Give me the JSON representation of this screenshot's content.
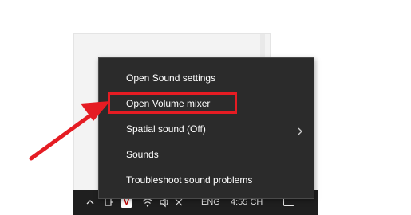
{
  "context_menu": {
    "items": [
      {
        "label": "Open Sound settings"
      },
      {
        "label": "Open Volume mixer"
      },
      {
        "label": "Spatial sound (Off)",
        "icon": "chevron-right-icon"
      },
      {
        "label": "Sounds"
      },
      {
        "label": "Troubleshoot sound problems"
      }
    ],
    "highlighted_item": "Open Volume mixer"
  },
  "taskbar": {
    "app_badge": "V",
    "language": "ENG",
    "clock": "4:55 CH",
    "icons": [
      "chevron-up-icon",
      "people-icon",
      "app-v-icon",
      "wifi-icon",
      "volume-icon",
      "mute-icon",
      "notification-icon"
    ]
  },
  "annotation": {
    "arrow_color": "#e51c23",
    "box_color": "#e51c23"
  }
}
